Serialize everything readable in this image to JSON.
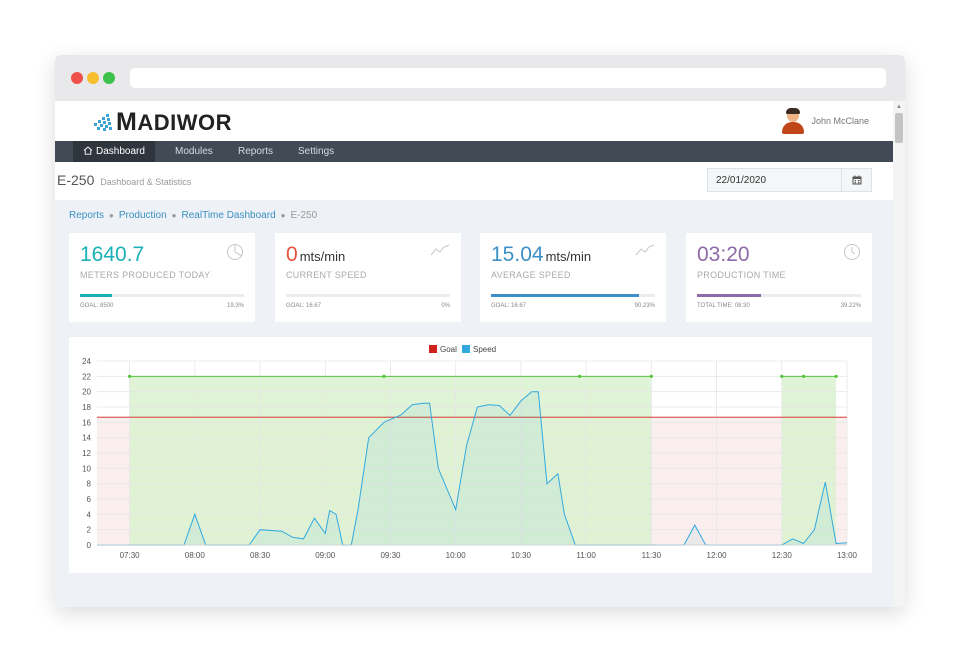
{
  "app": {
    "brand_rest": "ADIWOR",
    "brand_initial": "M",
    "user_name": "John McClane"
  },
  "nav": {
    "items": [
      {
        "label": "Dashboard",
        "icon": "home-icon",
        "active": true
      },
      {
        "label": "Modules"
      },
      {
        "label": "Reports"
      },
      {
        "label": "Settings"
      }
    ]
  },
  "header": {
    "title": "E-250",
    "subtitle": "Dashboard & Statistics",
    "date": "22/01/2020",
    "date_icon": "calendar-icon"
  },
  "breadcrumb": {
    "items": [
      "Reports",
      "Production",
      "RealTime Dashboard",
      "E-250"
    ]
  },
  "cards": [
    {
      "value": "1640.7",
      "unit": "",
      "label": "METERS PRODUCED TODAY",
      "goal": "GOAL: 8500",
      "pct": "19.3%",
      "progress": 0.193,
      "color": "#1ab0b6",
      "icon": "pie-chart-icon"
    },
    {
      "value": "0",
      "unit": "mts/min",
      "label": "CURRENT SPEED",
      "goal": "GOAL: 16.67",
      "pct": "0%",
      "progress": 0,
      "color": "#e5533e",
      "icon": "trend-line-icon"
    },
    {
      "value": "15.04",
      "unit": "mts/min",
      "label": "AVERAGE SPEED",
      "goal": "GOAL: 16.67",
      "pct": "90.23%",
      "progress": 0.9023,
      "color": "#3d8fc7",
      "icon": "trend-line-icon"
    },
    {
      "value": "03:20",
      "unit": "",
      "label": "PRODUCTION TIME",
      "goal": "TOTAL TIME: 08:30",
      "pct": "39.22%",
      "progress": 0.3922,
      "color": "#8e6ba8",
      "icon": "clock-icon"
    }
  ],
  "chart_data": {
    "type": "line",
    "legend": [
      {
        "name": "Goal",
        "color": "#d0211c"
      },
      {
        "name": "Speed",
        "color": "#32a9de"
      }
    ],
    "x_ticks": [
      "07:30",
      "08:00",
      "08:30",
      "09:00",
      "09:30",
      "10:00",
      "10:30",
      "11:00",
      "11:30",
      "12:00",
      "12:30",
      "13:00"
    ],
    "y_ticks": [
      "0",
      "2",
      "4",
      "6",
      "8",
      "10",
      "12",
      "14",
      "16",
      "18",
      "20",
      "22",
      "24"
    ],
    "ylim": [
      0,
      24
    ],
    "xlim": [
      "07:15",
      "13:00"
    ],
    "goal_value": 16.67,
    "running_periods": [
      {
        "start": "07:30",
        "end": "11:30"
      },
      {
        "start": "12:30",
        "end": "12:55"
      }
    ],
    "running_markers": [
      "07:30",
      "09:27",
      "10:57",
      "11:30",
      "12:30",
      "12:40",
      "12:55"
    ],
    "running_level": 22,
    "speed": [
      {
        "x": "07:15",
        "y": 0
      },
      {
        "x": "07:30",
        "y": 0
      },
      {
        "x": "07:55",
        "y": 0
      },
      {
        "x": "08:00",
        "y": 4
      },
      {
        "x": "08:05",
        "y": 0
      },
      {
        "x": "08:25",
        "y": 0
      },
      {
        "x": "08:30",
        "y": 2
      },
      {
        "x": "08:40",
        "y": 1.8
      },
      {
        "x": "08:45",
        "y": 1
      },
      {
        "x": "08:50",
        "y": 0.8
      },
      {
        "x": "08:55",
        "y": 3.5
      },
      {
        "x": "09:00",
        "y": 1.5
      },
      {
        "x": "09:02",
        "y": 4.5
      },
      {
        "x": "09:05",
        "y": 4
      },
      {
        "x": "09:08",
        "y": 0
      },
      {
        "x": "09:12",
        "y": 0
      },
      {
        "x": "09:15",
        "y": 4.5
      },
      {
        "x": "09:20",
        "y": 14
      },
      {
        "x": "09:27",
        "y": 16
      },
      {
        "x": "09:35",
        "y": 17
      },
      {
        "x": "09:40",
        "y": 18.3
      },
      {
        "x": "09:45",
        "y": 18.5
      },
      {
        "x": "09:48",
        "y": 18.5
      },
      {
        "x": "09:52",
        "y": 10
      },
      {
        "x": "10:00",
        "y": 4.6
      },
      {
        "x": "10:05",
        "y": 13
      },
      {
        "x": "10:10",
        "y": 18
      },
      {
        "x": "10:15",
        "y": 18.3
      },
      {
        "x": "10:20",
        "y": 18.2
      },
      {
        "x": "10:25",
        "y": 16.9
      },
      {
        "x": "10:30",
        "y": 18.8
      },
      {
        "x": "10:35",
        "y": 20
      },
      {
        "x": "10:38",
        "y": 20
      },
      {
        "x": "10:42",
        "y": 8
      },
      {
        "x": "10:47",
        "y": 9.3
      },
      {
        "x": "10:50",
        "y": 4
      },
      {
        "x": "10:55",
        "y": 0
      },
      {
        "x": "11:30",
        "y": 0
      },
      {
        "x": "11:45",
        "y": 0
      },
      {
        "x": "11:50",
        "y": 2.6
      },
      {
        "x": "11:55",
        "y": 0
      },
      {
        "x": "12:30",
        "y": 0
      },
      {
        "x": "12:35",
        "y": 0.8
      },
      {
        "x": "12:40",
        "y": 0.2
      },
      {
        "x": "12:45",
        "y": 2
      },
      {
        "x": "12:50",
        "y": 8.2
      },
      {
        "x": "12:55",
        "y": 0.2
      },
      {
        "x": "13:00",
        "y": 0.3
      }
    ]
  }
}
